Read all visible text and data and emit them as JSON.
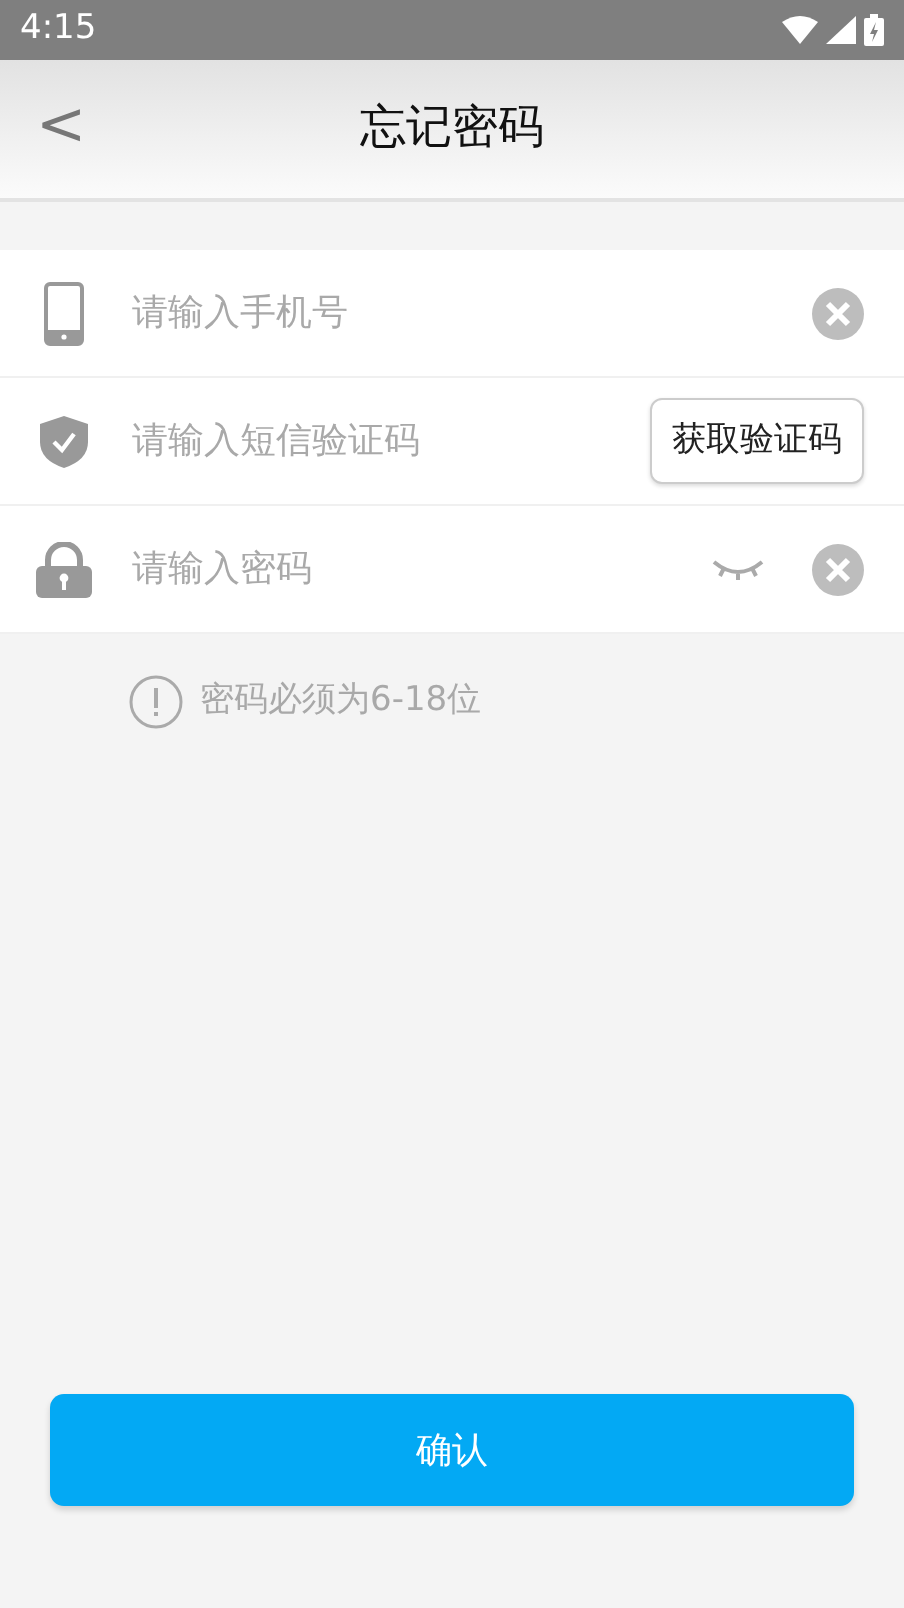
{
  "status_bar": {
    "time": "4:15"
  },
  "header": {
    "back": "<",
    "title": "忘记密码"
  },
  "fields": [
    {
      "kind": "phone",
      "placeholder": "请输入手机号",
      "clearable": true
    },
    {
      "kind": "code",
      "placeholder": "请输入短信验证码",
      "clearable": false,
      "action_button": "获取验证码"
    },
    {
      "kind": "password",
      "placeholder": "请输入密码",
      "clearable": true,
      "password_visible": false
    }
  ],
  "hint": "密码必须为6-18位",
  "confirm_button": "确认"
}
